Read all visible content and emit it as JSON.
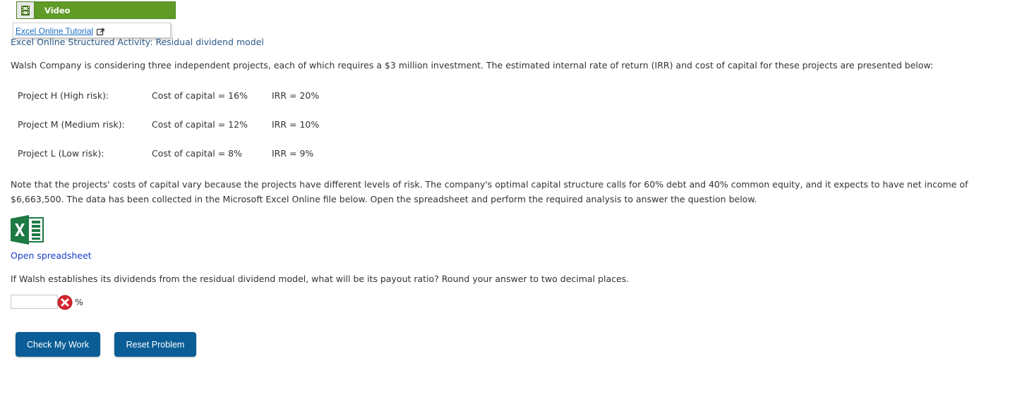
{
  "video_menu": {
    "label": "Video",
    "item_label": "Excel Online Tutorial"
  },
  "activity_title": "Excel Online Structured Activity: Residual dividend model",
  "intro": "Walsh Company is considering three independent projects, each of which requires a $3 million investment. The estimated internal rate of return (IRR) and cost of capital for these projects are presented below:",
  "projects": [
    {
      "name": "Project H (High risk):",
      "cost": "Cost of capital = 16%",
      "irr": "IRR = 20%"
    },
    {
      "name": "Project M (Medium risk):",
      "cost": "Cost of capital = 12%",
      "irr": "IRR = 10%"
    },
    {
      "name": "Project L (Low risk):",
      "cost": "Cost of capital = 8%",
      "irr": "IRR = 9%"
    }
  ],
  "note": "Note that the projects' costs of capital vary because the projects have different levels of risk. The company's optimal capital structure calls for 60% debt and 40% common equity, and it expects to have net income of $6,663,500. The data has been collected in the Microsoft Excel Online file below. Open the spreadsheet and perform the required analysis to answer the question below.",
  "open_spreadsheet_label": "Open spreadsheet",
  "question": "If Walsh establishes its dividends from the residual dividend model, what will be its payout ratio? Round your answer to two decimal places.",
  "answer": {
    "value": "",
    "unit": "%",
    "status_icon": "wrong-answer-icon"
  },
  "buttons": {
    "check_label": "Check My Work",
    "reset_label": "Reset Problem"
  },
  "colors": {
    "video_bar": "#5f9b25",
    "link": "#1a6fc0",
    "button": "#0a5d96",
    "error": "#d9262e",
    "excel_green": "#1d7a45"
  }
}
